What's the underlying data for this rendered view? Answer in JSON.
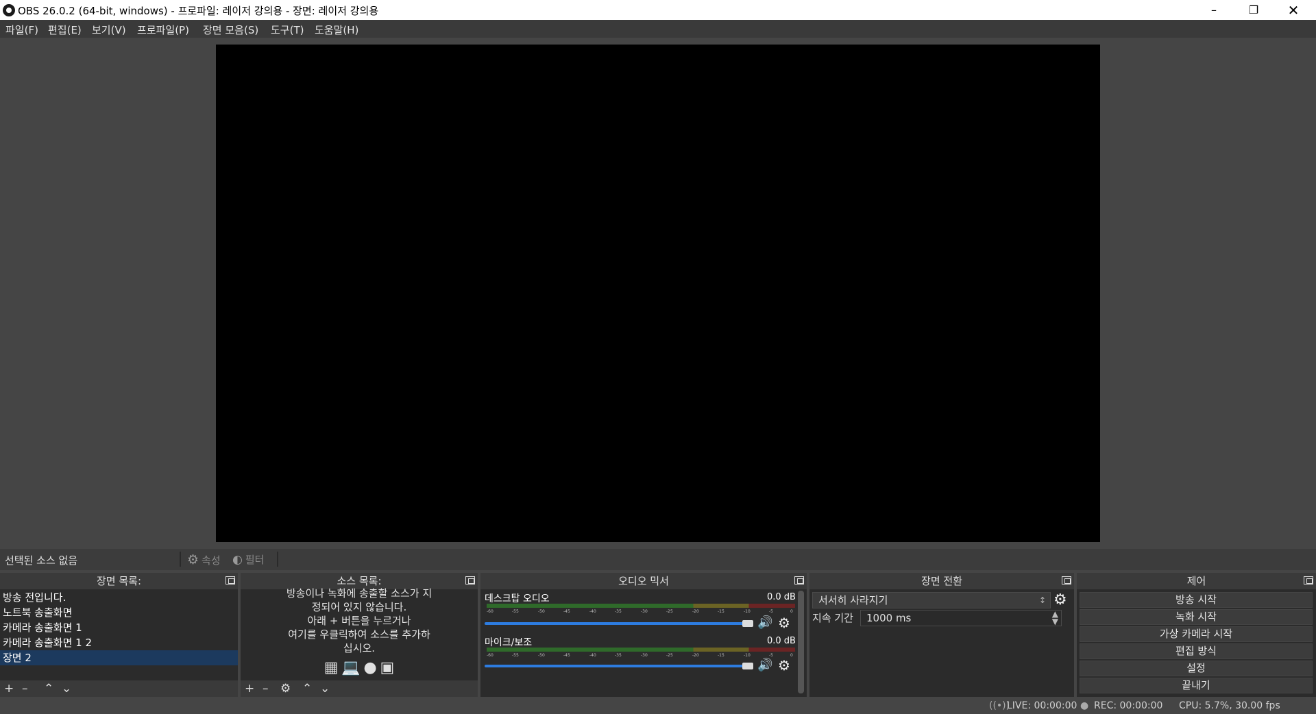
{
  "window": {
    "title": "OBS 26.0.2 (64-bit, windows) - 프로파일: 레이저 강의용 - 장면: 레이저 강의용"
  },
  "menu": [
    "파일(F)",
    "편집(E)",
    "보기(V)",
    "프로파일(P)",
    "장면 모음(S)",
    "도구(T)",
    "도움말(H)"
  ],
  "context_bar": {
    "no_source": "선택된 소스 없음",
    "properties": "속성",
    "filters": "필터"
  },
  "scenes": {
    "title": "장면 목록:",
    "items": [
      "방송 전입니다.",
      "노트북 송출화면",
      "카메라 송출화면 1",
      "카메라 송출화면 1 2",
      "장면 2"
    ],
    "selected_index": 4
  },
  "sources": {
    "title": "소스 목록:",
    "message_lines": [
      "방송이나 녹화에 송출할 소스가 지",
      "정되어 있지 않습니다.",
      "아래 + 버튼을 누르거나",
      "여기를 우클릭하여 소스를 추가하",
      "십시오."
    ]
  },
  "mixer": {
    "title": "오디오 믹서",
    "channels": [
      {
        "name": "데스크탑 오디오",
        "db": "0.0 dB",
        "volume": 1.0
      },
      {
        "name": "마이크/보조",
        "db": "0.0 dB",
        "volume": 1.0
      }
    ],
    "scale": [
      "-60",
      "-55",
      "-50",
      "-45",
      "-40",
      "-35",
      "-30",
      "-25",
      "-20",
      "-15",
      "-10",
      "-5",
      "0"
    ]
  },
  "transitions": {
    "title": "장면 전환",
    "selected": "서서히 사라지기",
    "duration_label": "지속 기간",
    "duration_value": "1000 ms"
  },
  "controls": {
    "title": "제어",
    "buttons": [
      "방송 시작",
      "녹화 시작",
      "가상 카메라 시작",
      "편집 방식",
      "설정",
      "끝내기"
    ]
  },
  "status": {
    "live": "LIVE: 00:00:00",
    "rec": "REC: 00:00:00",
    "cpu": "CPU: 5.7%, 30.00 fps"
  }
}
